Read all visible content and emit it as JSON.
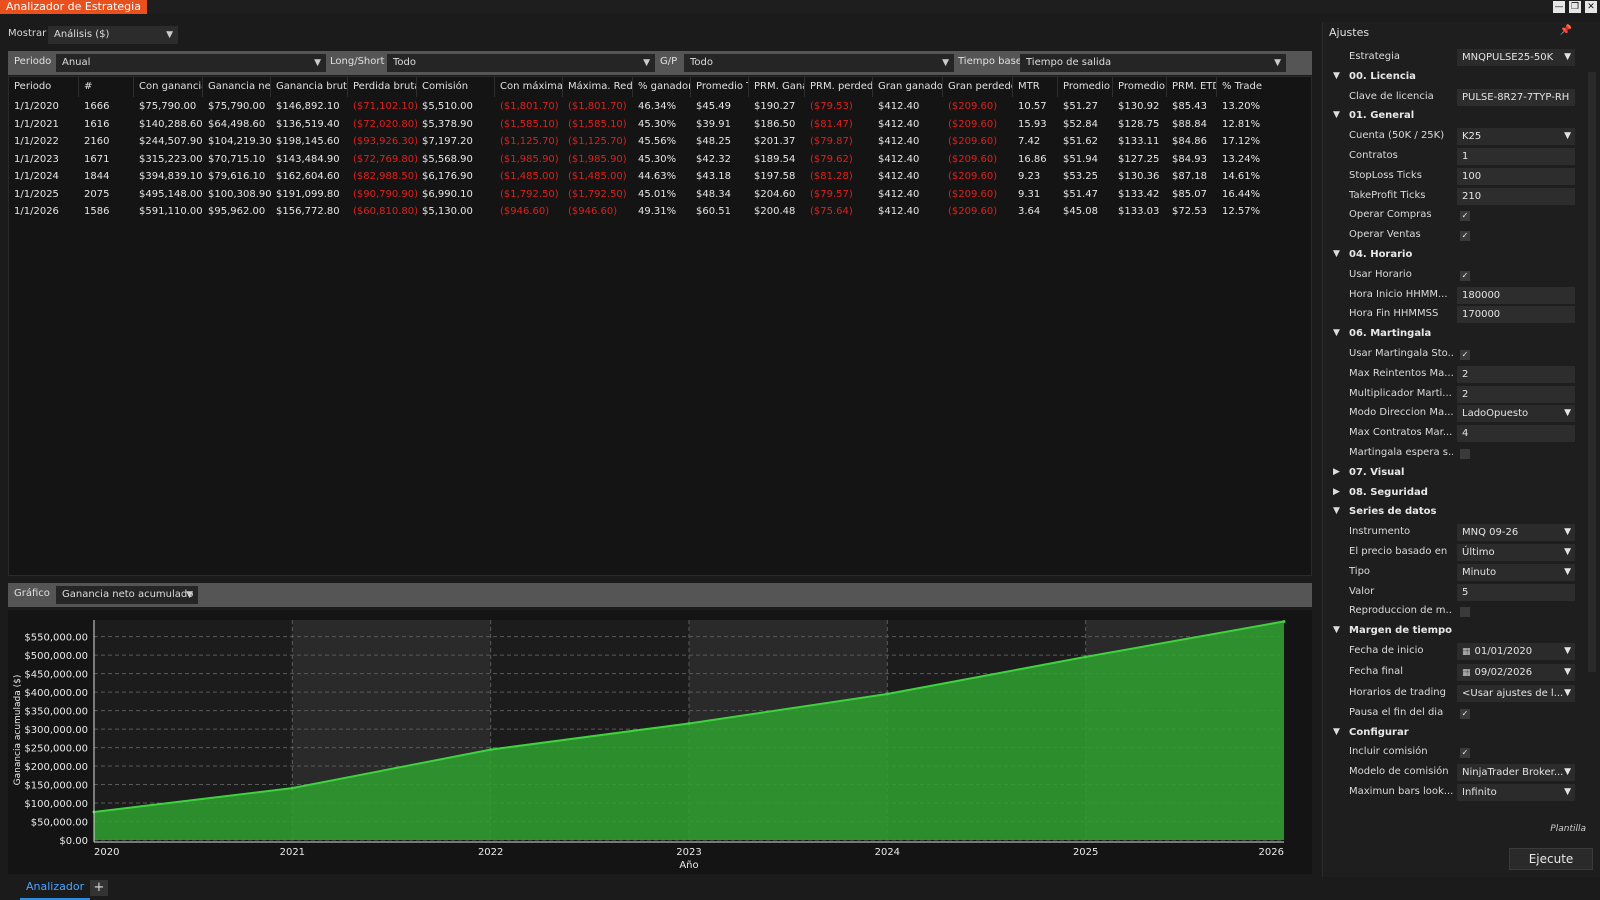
{
  "window": {
    "title": "Analizador de Estrategia",
    "minimize": "—",
    "restore": "❐",
    "close": "✕"
  },
  "show": {
    "label": "Mostrar",
    "value": "Análisis ($)"
  },
  "filters": [
    {
      "label": "Periodo",
      "value": "Anual"
    },
    {
      "label": "Long/Short",
      "value": "Todo"
    },
    {
      "label": "G/P",
      "value": "Todo"
    },
    {
      "label": "Tiempo base",
      "value": "Tiempo de salida"
    }
  ],
  "table": {
    "columns": [
      "Periodo",
      "#",
      "Con ganancia",
      "Ganancia neta",
      "Ganancia bruta",
      "Perdida bruta",
      "Comisión",
      "Con máxima",
      "Máxima. Redu",
      "% ganador",
      "Promedio T",
      "PRM. Ganar",
      "PRM. perdedor",
      "Gran ganador",
      "Gran perdedor",
      "MTR",
      "Promedio",
      "Promedio",
      "PRM. ETD",
      "% Trade"
    ],
    "rows": [
      [
        "1/1/2020",
        "1666",
        "$75,790.00",
        "$75,790.00",
        "$146,892.10",
        "($71,102.10)",
        "$5,510.00",
        "($1,801.70)",
        "($1,801.70)",
        "46.34%",
        "$45.49",
        "$190.27",
        "($79.53)",
        "$412.40",
        "($209.60)",
        "10.57",
        "$51.27",
        "$130.92",
        "$85.43",
        "13.20%"
      ],
      [
        "1/1/2021",
        "1616",
        "$140,288.60",
        "$64,498.60",
        "$136,519.40",
        "($72,020.80)",
        "$5,378.90",
        "($1,585.10)",
        "($1,585.10)",
        "45.30%",
        "$39.91",
        "$186.50",
        "($81.47)",
        "$412.40",
        "($209.60)",
        "15.93",
        "$52.84",
        "$128.75",
        "$88.84",
        "12.81%"
      ],
      [
        "1/1/2022",
        "2160",
        "$244,507.90",
        "$104,219.30",
        "$198,145.60",
        "($93,926.30)",
        "$7,197.20",
        "($1,125.70)",
        "($1,125.70)",
        "45.56%",
        "$48.25",
        "$201.37",
        "($79.87)",
        "$412.40",
        "($209.60)",
        "7.42",
        "$51.62",
        "$133.11",
        "$84.86",
        "17.12%"
      ],
      [
        "1/1/2023",
        "1671",
        "$315,223.00",
        "$70,715.10",
        "$143,484.90",
        "($72,769.80)",
        "$5,568.90",
        "($1,985.90)",
        "($1,985.90)",
        "45.30%",
        "$42.32",
        "$189.54",
        "($79.62)",
        "$412.40",
        "($209.60)",
        "16.86",
        "$51.94",
        "$127.25",
        "$84.93",
        "13.24%"
      ],
      [
        "1/1/2024",
        "1844",
        "$394,839.10",
        "$79,616.10",
        "$162,604.60",
        "($82,988.50)",
        "$6,176.90",
        "($1,485.00)",
        "($1,485.00)",
        "44.63%",
        "$43.18",
        "$197.58",
        "($81.28)",
        "$412.40",
        "($209.60)",
        "9.23",
        "$53.25",
        "$130.36",
        "$87.18",
        "14.61%"
      ],
      [
        "1/1/2025",
        "2075",
        "$495,148.00",
        "$100,308.90",
        "$191,099.80",
        "($90,790.90)",
        "$6,990.10",
        "($1,792.50)",
        "($1,792.50)",
        "45.01%",
        "$48.34",
        "$204.60",
        "($79.57)",
        "$412.40",
        "($209.60)",
        "9.31",
        "$51.47",
        "$133.42",
        "$85.07",
        "16.44%"
      ],
      [
        "1/1/2026",
        "1586",
        "$591,110.00",
        "$95,962.00",
        "$156,772.80",
        "($60,810.80)",
        "$5,130.00",
        "($946.60)",
        "($946.60)",
        "49.31%",
        "$60.51",
        "$200.48",
        "($75.64)",
        "$412.40",
        "($209.60)",
        "3.64",
        "$45.08",
        "$133.03",
        "$72.53",
        "12.57%"
      ]
    ]
  },
  "chart_controls": {
    "label": "Gráfico",
    "value": "Ganancia neto acumulado"
  },
  "colors": {
    "fill": "#2ea12e",
    "line": "#3fd23f",
    "negative": "#e0201d",
    "accent": "#e8511d",
    "tab": "#2d8cdf"
  },
  "chart_data": {
    "type": "area",
    "xlabel": "Año",
    "ylabel": "Ganancia acumulada ($)",
    "x": [
      "2020",
      "2021",
      "2022",
      "2023",
      "2024",
      "2025",
      "2026"
    ],
    "series": [
      {
        "values": [
          75790,
          140288.6,
          244507.9,
          315223,
          394839.1,
          495148,
          591110
        ]
      }
    ],
    "ylim": [
      0,
      595000
    ],
    "yticks": [
      "$0.00",
      "$50,000.00",
      "$100,000.00",
      "$150,000.00",
      "$200,000.00",
      "$250,000.00",
      "$300,000.00",
      "$350,000.00",
      "$400,000.00",
      "$450,000.00",
      "$500,000.00",
      "$550,000.00"
    ],
    "ytick_values": [
      0,
      50000,
      100000,
      150000,
      200000,
      250000,
      300000,
      350000,
      400000,
      450000,
      500000,
      550000
    ],
    "grid": true
  },
  "bottom_tabs": {
    "active": "Analizador",
    "add": "+"
  },
  "sidebar": {
    "title": "Ajustes",
    "pin_icon": "pin-icon",
    "rows": [
      {
        "kind": "field",
        "label": "Estrategia",
        "value": "MNQPULSE25-50K",
        "dropdown": true
      },
      {
        "kind": "section",
        "title": "00. Licencia",
        "expanded": true
      },
      {
        "kind": "field",
        "label": "Clave de licencia",
        "value": "PULSE-8R27-7TYP-RH"
      },
      {
        "kind": "section",
        "title": "01. General",
        "expanded": true
      },
      {
        "kind": "field",
        "label": "Cuenta (50K / 25K)",
        "value": "K25",
        "dropdown": true
      },
      {
        "kind": "field",
        "label": "Contratos",
        "value": "1"
      },
      {
        "kind": "field",
        "label": "StopLoss Ticks",
        "value": "100"
      },
      {
        "kind": "field",
        "label": "TakeProfit Ticks",
        "value": "210"
      },
      {
        "kind": "check",
        "label": "Operar Compras",
        "checked": true
      },
      {
        "kind": "check",
        "label": "Operar Ventas",
        "checked": true
      },
      {
        "kind": "section",
        "title": "04. Horario",
        "expanded": true
      },
      {
        "kind": "check",
        "label": "Usar Horario",
        "checked": true
      },
      {
        "kind": "field",
        "label": "Hora Inicio HHMM...",
        "value": "180000"
      },
      {
        "kind": "field",
        "label": "Hora Fin HHMMSS",
        "value": "170000"
      },
      {
        "kind": "section",
        "title": "06. Martingala",
        "expanded": true
      },
      {
        "kind": "check",
        "label": "Usar Martingala Sto...",
        "checked": true
      },
      {
        "kind": "field",
        "label": "Max Reintentos Ma...",
        "value": "2"
      },
      {
        "kind": "field",
        "label": "Multiplicador Marti...",
        "value": "2"
      },
      {
        "kind": "field",
        "label": "Modo Direccion Ma...",
        "value": "LadoOpuesto",
        "dropdown": true
      },
      {
        "kind": "field",
        "label": "Max Contratos Mar...",
        "value": "4"
      },
      {
        "kind": "check",
        "label": "Martingala espera s...",
        "checked": false
      },
      {
        "kind": "section",
        "title": "07. Visual",
        "expanded": false
      },
      {
        "kind": "section",
        "title": "08. Seguridad",
        "expanded": false
      },
      {
        "kind": "section",
        "title": "Series de datos",
        "expanded": true
      },
      {
        "kind": "field",
        "label": "Instrumento",
        "value": "MNQ 09-26",
        "dropdown": true
      },
      {
        "kind": "field",
        "label": "El precio basado en",
        "value": "Último",
        "dropdown": true
      },
      {
        "kind": "field",
        "label": "Tipo",
        "value": "Minuto",
        "dropdown": true
      },
      {
        "kind": "field",
        "label": "Valor",
        "value": "5"
      },
      {
        "kind": "check",
        "label": "Reproduccion de m...",
        "checked": false
      },
      {
        "kind": "section",
        "title": "Margen de tiempo",
        "expanded": true
      },
      {
        "kind": "field",
        "label": "Fecha de inicio",
        "value": "01/01/2020",
        "dropdown": true,
        "calendar": true
      },
      {
        "kind": "field",
        "label": "Fecha final",
        "value": "09/02/2026",
        "dropdown": true,
        "calendar": true
      },
      {
        "kind": "field",
        "label": "Horarios de trading",
        "value": "<Usar ajustes de l...",
        "dropdown": true
      },
      {
        "kind": "check",
        "label": "Pausa el fin del dia",
        "checked": true
      },
      {
        "kind": "section",
        "title": "Configurar",
        "expanded": true
      },
      {
        "kind": "check",
        "label": "Incluir comisión",
        "checked": true
      },
      {
        "kind": "field",
        "label": "Modelo de comisión",
        "value": "NinjaTrader Broker...",
        "dropdown": true
      },
      {
        "kind": "field",
        "label": "Maximun bars look...",
        "value": "Infinito",
        "dropdown": true
      }
    ],
    "template_label": "Plantilla",
    "run_button": "Ejecute"
  }
}
